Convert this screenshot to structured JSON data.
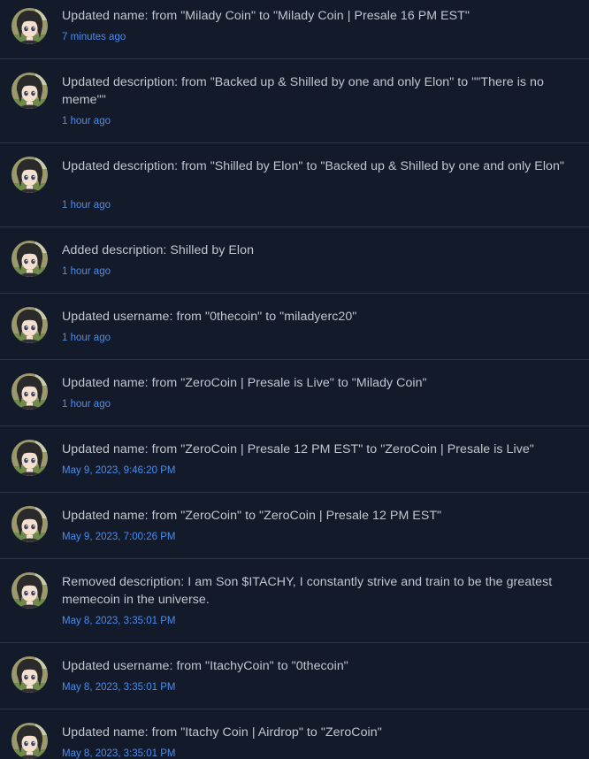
{
  "activity": [
    {
      "text": "Updated name: from \"Milady Coin\" to \"Milady Coin | Presale 16 PM EST\"",
      "time": "7 minutes ago",
      "avatar": "anime-girl-avatar"
    },
    {
      "text": "Updated description: from \"Backed up & Shilled by one and only Elon\" to \"\"There is no meme\"\"",
      "time": "1 hour ago",
      "avatar": "anime-girl-avatar"
    },
    {
      "text": "Updated description: from \"Shilled by Elon\" to \"Backed up & Shilled by one and only Elon\"",
      "time": "1 hour ago",
      "avatar": "anime-girl-avatar"
    },
    {
      "text": "Added description: Shilled by Elon",
      "time": "1 hour ago",
      "avatar": "anime-girl-avatar"
    },
    {
      "text": "Updated username: from \"0thecoin\" to \"miladyerc20\"",
      "time": "1 hour ago",
      "avatar": "anime-girl-avatar"
    },
    {
      "text": "Updated name: from \"ZeroCoin | Presale is Live\" to \"Milady Coin\"",
      "time": "1 hour ago",
      "avatar": "anime-girl-avatar"
    },
    {
      "text": "Updated name: from \"ZeroCoin | Presale 12 PM EST\" to \"ZeroCoin | Presale is Live\"",
      "time": "May 9, 2023, 9:46:20 PM",
      "avatar": "anime-girl-avatar"
    },
    {
      "text": "Updated name: from \"ZeroCoin\" to \"ZeroCoin | Presale 12 PM EST\"",
      "time": "May 9, 2023, 7:00:26 PM",
      "avatar": "anime-girl-avatar"
    },
    {
      "text": "Removed description: I am Son $ITACHY, I constantly strive and train to be the greatest memecoin in the universe.",
      "time": "May 8, 2023, 3:35:01 PM",
      "avatar": "anime-girl-avatar"
    },
    {
      "text": "Updated username: from \"ItachyCoin\" to \"0thecoin\"",
      "time": "May 8, 2023, 3:35:01 PM",
      "avatar": "anime-girl-avatar"
    },
    {
      "text": "Updated name: from \"Itachy Coin | Airdrop\" to \"ZeroCoin\"",
      "time": "May 8, 2023, 3:35:01 PM",
      "avatar": "anime-girl-avatar"
    }
  ],
  "colors": {
    "background": "#131a2a",
    "text": "#c2c6ce",
    "timestamp": "#4b8df0",
    "divider": "#2e3646"
  }
}
